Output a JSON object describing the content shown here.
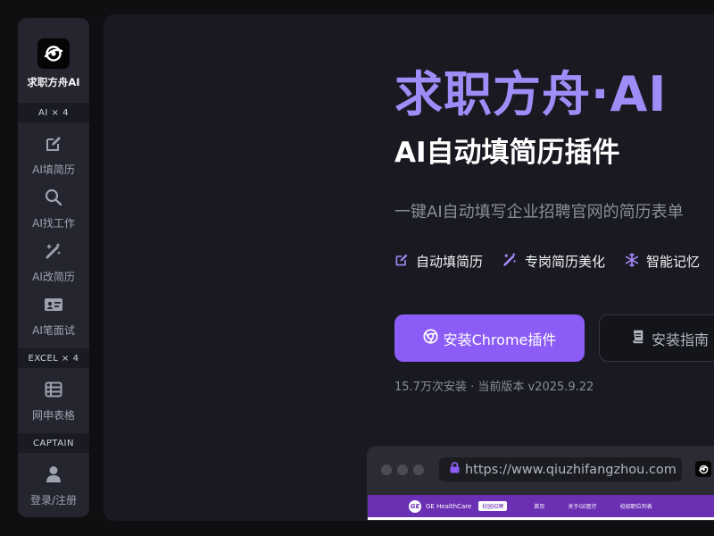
{
  "sidebar": {
    "brand": "求职方舟AI",
    "sections": [
      {
        "label": "AI × 4"
      },
      {
        "label": "EXCEL × 4"
      },
      {
        "label": "CAPTAIN"
      }
    ],
    "items": [
      {
        "label": "AI填简历",
        "icon": "edit-icon"
      },
      {
        "label": "AI找工作",
        "icon": "search-icon"
      },
      {
        "label": "AI改简历",
        "icon": "magic-wand-icon"
      },
      {
        "label": "AI笔面试",
        "icon": "id-card-icon"
      },
      {
        "label": "网申表格",
        "icon": "table-icon"
      },
      {
        "label": "登录/注册",
        "icon": "user-icon"
      }
    ]
  },
  "hero": {
    "title": "求职方舟·AI",
    "subtitle": "AI自动填简历插件",
    "description": "一键AI自动填写企业招聘官网的简历表单",
    "features": [
      {
        "label": "自动填简历",
        "icon": "edit-icon"
      },
      {
        "label": "专岗简历美化",
        "icon": "magic-wand-icon"
      },
      {
        "label": "智能记忆",
        "icon": "snowflake-icon"
      }
    ],
    "primary_button": "安装Chrome插件",
    "secondary_button": "安装指南",
    "install_info": "15.7万次安装 · 当前版本 v2025.9.22"
  },
  "browser": {
    "url": "https://www.qiuzhifangzhou.com",
    "site": {
      "logo_text": "GE",
      "name": "GE HealthCare",
      "badge": "校园招聘",
      "links": [
        "首页",
        "关于GE医疗",
        "校招职位列表"
      ]
    }
  },
  "colors": {
    "accent": "#8b5cf6",
    "title": "#9f8cf6",
    "sidebar_bg": "#24252e",
    "panel_bg": "#181921",
    "site_nav": "#6b2fb3"
  }
}
